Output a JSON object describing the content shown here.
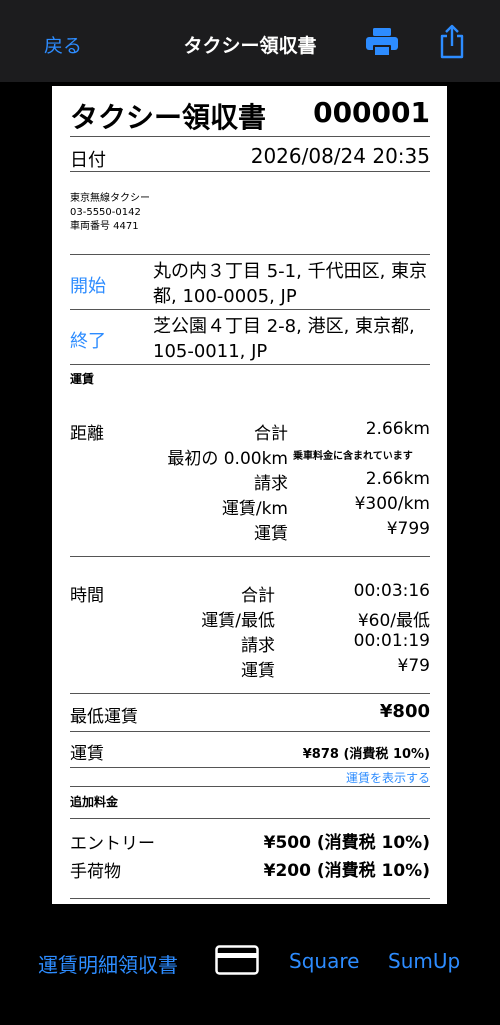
{
  "nav": {
    "back_label": "戻る",
    "title": "タクシー領収書",
    "print_icon": "printer-icon",
    "share_icon": "share-icon"
  },
  "receipt": {
    "title": "タクシー領収書",
    "number": "000001",
    "date_label": "日付",
    "date_value": "2026/08/24 20:35",
    "company": {
      "name": "東京無線タクシー",
      "phone": "03-5550-0142",
      "vehicle": "車両番号 4471"
    },
    "start_label": "開始",
    "start_address": "丸の内３丁目 5-1, 千代田区, 東京都, 100-0005, JP",
    "end_label": "終了",
    "end_address": "芝公園４丁目 2-8, 港区, 東京都, 105-0011, JP",
    "fare_heading": "運賃",
    "distance": {
      "label": "距離",
      "total_label": "合計",
      "total_value": "2.66km",
      "first_label": "最初の 0.00km",
      "first_note": "乗車料金に含まれています",
      "billed_label": "請求",
      "billed_value": "2.66km",
      "rate_label": "運賃/km",
      "rate_value": "¥300/km",
      "fare_label": "運賃",
      "fare_value": "¥799"
    },
    "time": {
      "label": "時間",
      "total_label": "合計",
      "total_value": "00:03:16",
      "rate_label": "運賃/最低",
      "rate_value": "¥60/最低",
      "billed_label": "請求",
      "billed_value": "00:01:19",
      "fare_label": "運賃",
      "fare_value": "¥79"
    },
    "min_fare_label": "最低運賃",
    "min_fare_value": "¥800",
    "fare_label": "運賃",
    "fare_value": "¥878 (消費税 10%)",
    "show_fare_link": "運賃を表示する",
    "extras_heading": "追加料金",
    "entry_label": "エントリー",
    "entry_value": "¥500 (消費税 10%)",
    "luggage_label": "手荷物",
    "luggage_value": "¥200 (消費税 10%)"
  },
  "toolbar": {
    "itemized_label": "運賃明細領収書",
    "card_icon": "credit-card-icon",
    "square_label": "Square",
    "sumup_label": "SumUp"
  },
  "colors": {
    "accent": "#2d8cff",
    "navbar_bg": "#1c1c1e",
    "background": "#000000",
    "paper": "#ffffff"
  }
}
